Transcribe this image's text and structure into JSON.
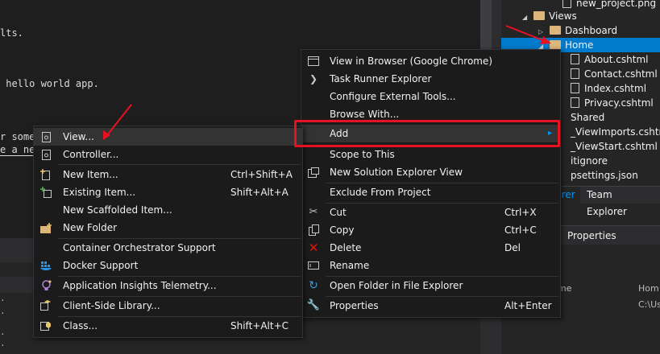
{
  "editor": {
    "lines": [
      {
        "text": "lts."
      },
      {
        "text": " hello world app."
      },
      {
        "text": "r some"
      },
      {
        "text": "e a new"
      }
    ],
    "bottom_dots": [
      ".",
      ".",
      ".",
      "."
    ]
  },
  "solution_explorer": {
    "items": [
      {
        "label": "new_project.png",
        "type": "file",
        "expander": ""
      },
      {
        "label": "Views",
        "type": "folder",
        "expander": "◢"
      },
      {
        "label": "Dashboard",
        "type": "folder",
        "expander": "▷"
      },
      {
        "label": "Home",
        "type": "folder",
        "expander": "◢",
        "selected": true
      },
      {
        "label": "About.cshtml",
        "type": "file",
        "expander": ""
      },
      {
        "label": "Contact.cshtml",
        "type": "file",
        "expander": ""
      },
      {
        "label": "Index.cshtml",
        "type": "file",
        "expander": ""
      },
      {
        "label": "Privacy.cshtml",
        "type": "file",
        "expander": ""
      },
      {
        "label": "Shared",
        "type": "partial",
        "expander": ""
      },
      {
        "label": "_ViewImports.cshtml",
        "type": "partial",
        "expander": ""
      },
      {
        "label": "_ViewStart.cshtml",
        "type": "partial",
        "expander": ""
      },
      {
        "label": "itignore",
        "type": "partial",
        "expander": ""
      },
      {
        "label": "psettings.json",
        "type": "partial",
        "expander": ""
      }
    ],
    "tabs": [
      {
        "label": "lorer"
      },
      {
        "label": "Team Explorer"
      }
    ],
    "properties_title": "Properties",
    "props": {
      "col1": "me",
      "col2": "Hom",
      "val2": "C:\\Us"
    }
  },
  "context_menu_main": {
    "items": [
      {
        "label": "View in Browser (Google Chrome)",
        "shortcut": "",
        "icon": "browser-icon"
      },
      {
        "label": "Task Runner Explorer",
        "shortcut": "",
        "icon": "task-runner-icon"
      },
      {
        "label": "Configure External Tools...",
        "shortcut": "",
        "icon": ""
      },
      {
        "label": "Browse With...",
        "shortcut": "",
        "icon": ""
      },
      {
        "label": "Add",
        "shortcut": "",
        "icon": "",
        "submenu": true
      },
      {
        "label": "Scope to This",
        "shortcut": "",
        "icon": ""
      },
      {
        "label": "New Solution Explorer View",
        "shortcut": "",
        "icon": "new-view-icon"
      },
      {
        "label": "Exclude From Project",
        "shortcut": "",
        "icon": ""
      },
      {
        "label": "Cut",
        "shortcut": "Ctrl+X",
        "icon": "cut-icon"
      },
      {
        "label": "Copy",
        "shortcut": "Ctrl+C",
        "icon": "copy-icon"
      },
      {
        "label": "Delete",
        "shortcut": "Del",
        "icon": "delete-icon"
      },
      {
        "label": "Rename",
        "shortcut": "",
        "icon": "rename-icon"
      },
      {
        "label": "Open Folder in File Explorer",
        "shortcut": "",
        "icon": "refresh-folder-icon"
      },
      {
        "label": "Properties",
        "shortcut": "Alt+Enter",
        "icon": "wrench-icon"
      }
    ],
    "submenu_arrow": "▸"
  },
  "context_menu_add": {
    "items": [
      {
        "label": "View...",
        "shortcut": "",
        "icon": "view-item-icon"
      },
      {
        "label": "Controller...",
        "shortcut": "",
        "icon": "controller-icon"
      },
      {
        "label": "New Item...",
        "shortcut": "Ctrl+Shift+A",
        "icon": "new-item-icon"
      },
      {
        "label": "Existing Item...",
        "shortcut": "Shift+Alt+A",
        "icon": "existing-item-icon"
      },
      {
        "label": "New Scaffolded Item...",
        "shortcut": "",
        "icon": ""
      },
      {
        "label": "New Folder",
        "shortcut": "",
        "icon": "new-folder-icon"
      },
      {
        "label": "Container Orchestrator Support",
        "shortcut": "",
        "icon": ""
      },
      {
        "label": "Docker Support",
        "shortcut": "",
        "icon": "docker-icon"
      },
      {
        "label": "Application Insights Telemetry...",
        "shortcut": "",
        "icon": "insights-icon"
      },
      {
        "label": "Client-Side Library...",
        "shortcut": "",
        "icon": "library-icon"
      },
      {
        "label": "Class...",
        "shortcut": "Shift+Alt+C",
        "icon": "class-icon"
      }
    ]
  },
  "colors": {
    "annotation_red": "#e81123",
    "selection_blue": "#007acc",
    "menu_bg": "#1b1b1c"
  }
}
